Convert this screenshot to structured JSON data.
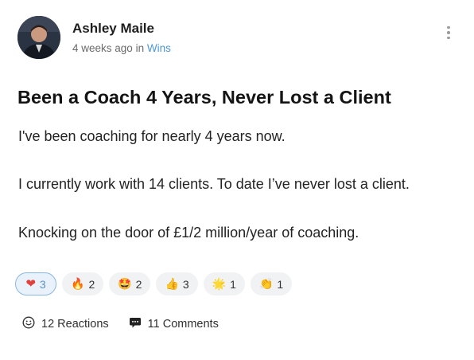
{
  "post": {
    "author": "Ashley Maile",
    "time_ago": "4 weeks ago",
    "in_word": "in",
    "category": "Wins",
    "title": "Been a Coach 4 Years, Never Lost a Client",
    "paragraphs": [
      "I've been coaching for nearly 4 years now.",
      "I currently work with 14 clients. To date I’ve never lost a client.",
      "Knocking on the door of  £1/2 million/year of coaching."
    ]
  },
  "reactions": [
    {
      "icon": "heart-icon",
      "emoji": "❤",
      "count": "3",
      "active": true
    },
    {
      "icon": "fire-icon",
      "emoji": "🔥",
      "count": "2",
      "active": false
    },
    {
      "icon": "star-struck-icon",
      "emoji": "🤩",
      "count": "2",
      "active": false
    },
    {
      "icon": "thumbs-up-icon",
      "emoji": "👍",
      "count": "3",
      "active": false
    },
    {
      "icon": "sparkle-star-icon",
      "emoji": "🌟",
      "count": "1",
      "active": false
    },
    {
      "icon": "clapping-hands-icon",
      "emoji": "👏",
      "count": "1",
      "active": false
    }
  ],
  "footer": {
    "reactions_label": "12 Reactions",
    "comments_label": "11 Comments"
  },
  "colors": {
    "link_blue": "#4c97d8",
    "active_border": "#8ab7e2",
    "heart_red": "#e0413e"
  }
}
